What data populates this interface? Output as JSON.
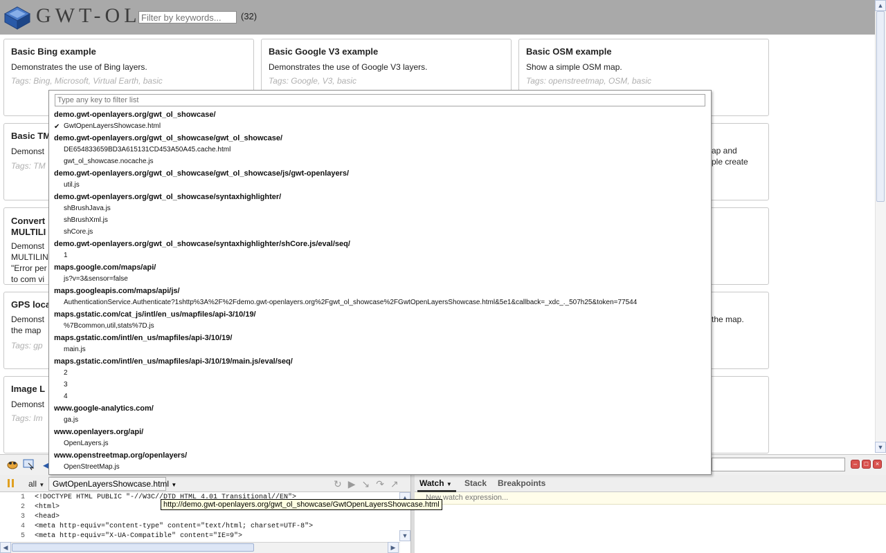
{
  "header": {
    "logo_text": "GWT-OL",
    "filter_placeholder": "Filter by keywords...",
    "count": "(32)"
  },
  "cards": [
    {
      "title": "Basic Bing example",
      "desc": "Demonstrates the use of Bing layers.",
      "tags": "Tags: Bing, Microsoft, Virtual Earth, basic"
    },
    {
      "title": "Basic Google V3 example",
      "desc": "Demonstrates the use of Google V3 layers.",
      "tags": "Tags: Google, V3, basic"
    },
    {
      "title": "Basic OSM example",
      "desc": "Show a simple OSM map.",
      "tags": "Tags: openstreetmap, OSM, basic"
    }
  ],
  "partial": {
    "basic_tm": "Basic TM",
    "demonst": "Demonst",
    "tags_tm": "Tags: TM",
    "convert": "Convert",
    "multili": "MULTILI",
    "multilin": "MULTILIN",
    "error_per": "\"Error per",
    "to_com": "to com vi",
    "gps": "GPS loca",
    "the_map": "the map",
    "tags_gp": "Tags: gp",
    "image": "Image L",
    "tags_im": "Tags: Im",
    "ap_and": "ap and",
    "ple_create": "ple create",
    "the_map_r": "the map."
  },
  "popup": {
    "filter_placeholder": "Type any key to filter list",
    "groups": [
      {
        "label": "demo.gwt-openlayers.org/gwt_ol_showcase/",
        "items": [
          "GwtOpenLayersShowcase.html"
        ]
      },
      {
        "label": "demo.gwt-openlayers.org/gwt_ol_showcase/gwt_ol_showcase/",
        "items": [
          "DE654833659BD3A615131CD453A50A45.cache.html",
          "gwt_ol_showcase.nocache.js"
        ]
      },
      {
        "label": "demo.gwt-openlayers.org/gwt_ol_showcase/gwt_ol_showcase/js/gwt-openlayers/",
        "items": [
          "util.js"
        ]
      },
      {
        "label": "demo.gwt-openlayers.org/gwt_ol_showcase/syntaxhighlighter/",
        "items": [
          "shBrushJava.js",
          "shBrushXml.js",
          "shCore.js"
        ]
      },
      {
        "label": "demo.gwt-openlayers.org/gwt_ol_showcase/syntaxhighlighter/shCore.js/eval/seq/",
        "items": [
          "1"
        ]
      },
      {
        "label": "maps.google.com/maps/api/",
        "items": [
          "js?v=3&sensor=false"
        ]
      },
      {
        "label": "maps.googleapis.com/maps/api/js/",
        "items": [
          "AuthenticationService.Authenticate?1shttp%3A%2F%2Fdemo.gwt-openlayers.org%2Fgwt_ol_showcase%2FGwtOpenLayersShowcase.html&5e1&callback=_xdc_._507h25&token=77544"
        ]
      },
      {
        "label": "maps.gstatic.com/cat_js/intl/en_us/mapfiles/api-3/10/19/",
        "items": [
          "%7Bcommon,util,stats%7D.js"
        ]
      },
      {
        "label": "maps.gstatic.com/intl/en_us/mapfiles/api-3/10/19/",
        "items": [
          "main.js"
        ]
      },
      {
        "label": "maps.gstatic.com/intl/en_us/mapfiles/api-3/10/19/main.js/eval/seq/",
        "items": [
          "2",
          "3",
          "4"
        ]
      },
      {
        "label": "www.google-analytics.com/",
        "items": [
          "ga.js"
        ]
      },
      {
        "label": "www.openlayers.org/api/",
        "items": [
          "OpenLayers.js"
        ]
      },
      {
        "label": "www.openstreetmap.org/openlayers/",
        "items": [
          "OpenStreetMap.js"
        ]
      }
    ]
  },
  "firebug": {
    "filter_all": "all",
    "script_selected": "GwtOpenLayersShowcase.html",
    "tabs": {
      "watch": "Watch",
      "stack": "Stack",
      "breakpoints": "Breakpoints"
    },
    "watch_placeholder": "New watch expression...",
    "tooltip": "http://demo.gwt-openlayers.org/gwt_ol_showcase/GwtOpenLayersShowcase.html",
    "code": [
      {
        "n": "1",
        "text": "<!DOCTYPE HTML PUBLIC \"-//W3C//DTD HTML 4.01 Transitional//EN\">"
      },
      {
        "n": "2",
        "text": "<html>"
      },
      {
        "n": "3",
        "text": "<head>"
      },
      {
        "n": "4",
        "text": "<meta http-equiv=\"content-type\" content=\"text/html; charset=UTF-8\">"
      },
      {
        "n": "5",
        "text": "<meta http-equiv=\"X-UA-Compatible\" content=\"IE=9\">"
      }
    ]
  }
}
